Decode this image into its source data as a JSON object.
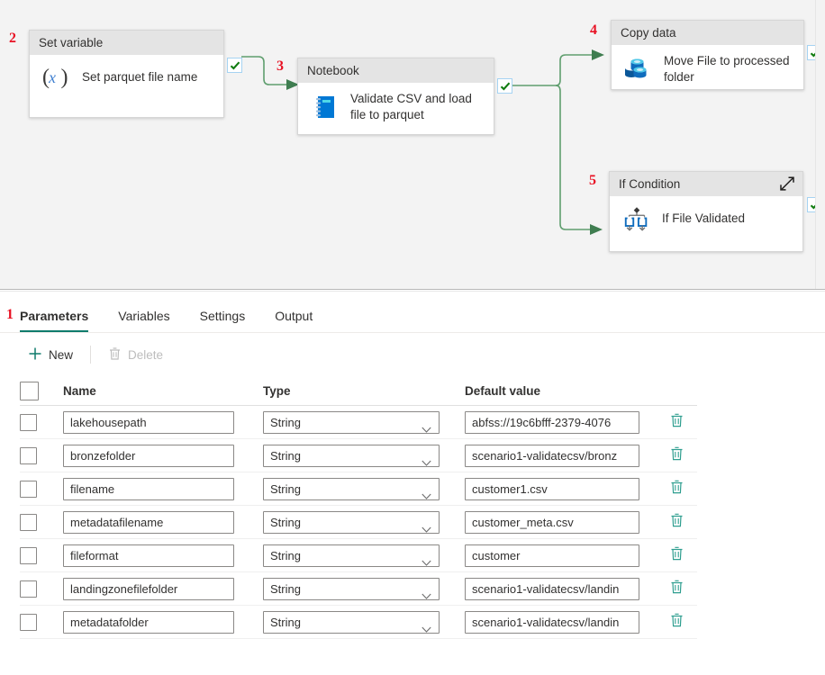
{
  "canvas": {
    "nodes": [
      {
        "step": "2",
        "type": "Set variable",
        "label": "Set parquet file name",
        "icon": "set-variable-icon",
        "status": "succeeded"
      },
      {
        "step": "3",
        "type": "Notebook",
        "label": "Validate CSV and load file to parquet",
        "icon": "notebook-icon",
        "status": "succeeded"
      },
      {
        "step": "4",
        "type": "Copy data",
        "label": "Move File to processed folder",
        "icon": "copy-data-icon",
        "status": "succeeded"
      },
      {
        "step": "5",
        "type": "If Condition",
        "label": "If File Validated",
        "icon": "if-condition-icon",
        "status": "succeeded",
        "expand_icon": "expand-diagonal-icon"
      }
    ]
  },
  "panel": {
    "step": "1",
    "tabs": [
      {
        "label": "Parameters",
        "active": true
      },
      {
        "label": "Variables",
        "active": false
      },
      {
        "label": "Settings",
        "active": false
      },
      {
        "label": "Output",
        "active": false
      }
    ],
    "toolbar": {
      "new_label": "New",
      "new_icon": "plus-icon",
      "delete_label": "Delete",
      "delete_icon": "trash-icon",
      "delete_disabled": true
    },
    "table": {
      "columns": [
        "Name",
        "Type",
        "Default value"
      ],
      "rows": [
        {
          "name": "lakehousepath",
          "type": "String",
          "value": "abfss://19c6bfff-2379-4076"
        },
        {
          "name": "bronzefolder",
          "type": "String",
          "value": "scenario1-validatecsv/bronz"
        },
        {
          "name": "filename",
          "type": "String",
          "value": "customer1.csv"
        },
        {
          "name": "metadatafilename",
          "type": "String",
          "value": "customer_meta.csv"
        },
        {
          "name": "fileformat",
          "type": "String",
          "value": "customer"
        },
        {
          "name": "landingzonefilefolder",
          "type": "String",
          "value": "scenario1-validatecsv/landin"
        },
        {
          "name": "metadatafolder",
          "type": "String",
          "value": "scenario1-validatecsv/landin"
        }
      ],
      "row_delete_icon": "trash-icon",
      "type_chevron_icon": "chevron-down-icon"
    }
  },
  "colors": {
    "accent": "#0f7b6c",
    "step_marker": "#e81123",
    "connector": "#5f9e6e",
    "success_check": "#107c10",
    "canvas_bg": "#f3f3f3",
    "node_header_bg": "#e4e4e4"
  }
}
